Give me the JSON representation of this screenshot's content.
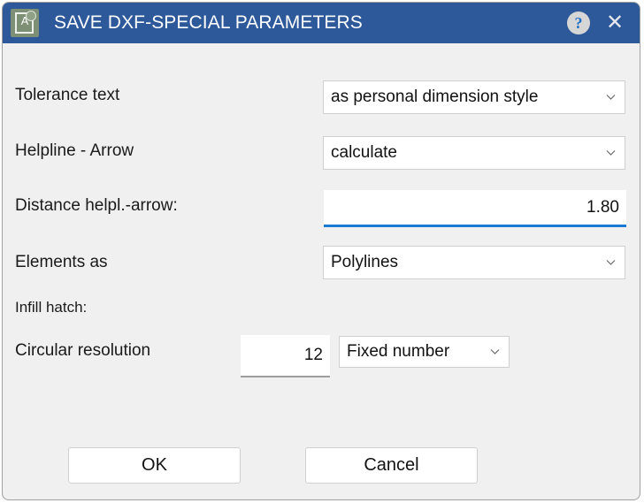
{
  "window": {
    "title": "SAVE DXF-SPECIAL PARAMETERS",
    "app_icon": "document-a-icon",
    "app_icon_letter": "A",
    "help_label": "?",
    "close_label": "✕",
    "titlebar_color": "#2d5899",
    "background_color": "#f0f0f0",
    "accent_color": "#1a7ad4"
  },
  "form": {
    "tolerance_text": {
      "label": "Tolerance text",
      "value": "as personal dimension style"
    },
    "helpline_arrow": {
      "label": "Helpline - Arrow",
      "value": "calculate"
    },
    "distance": {
      "label": "Distance helpl.-arrow:",
      "value": "1.80"
    },
    "elements_as": {
      "label": "Elements as",
      "value": "Polylines"
    },
    "infill_hatch": {
      "label": "Infill hatch:"
    },
    "circular_resolution": {
      "label": "Circular resolution",
      "value": "12",
      "mode": "Fixed number"
    }
  },
  "buttons": {
    "ok": "OK",
    "cancel": "Cancel"
  }
}
